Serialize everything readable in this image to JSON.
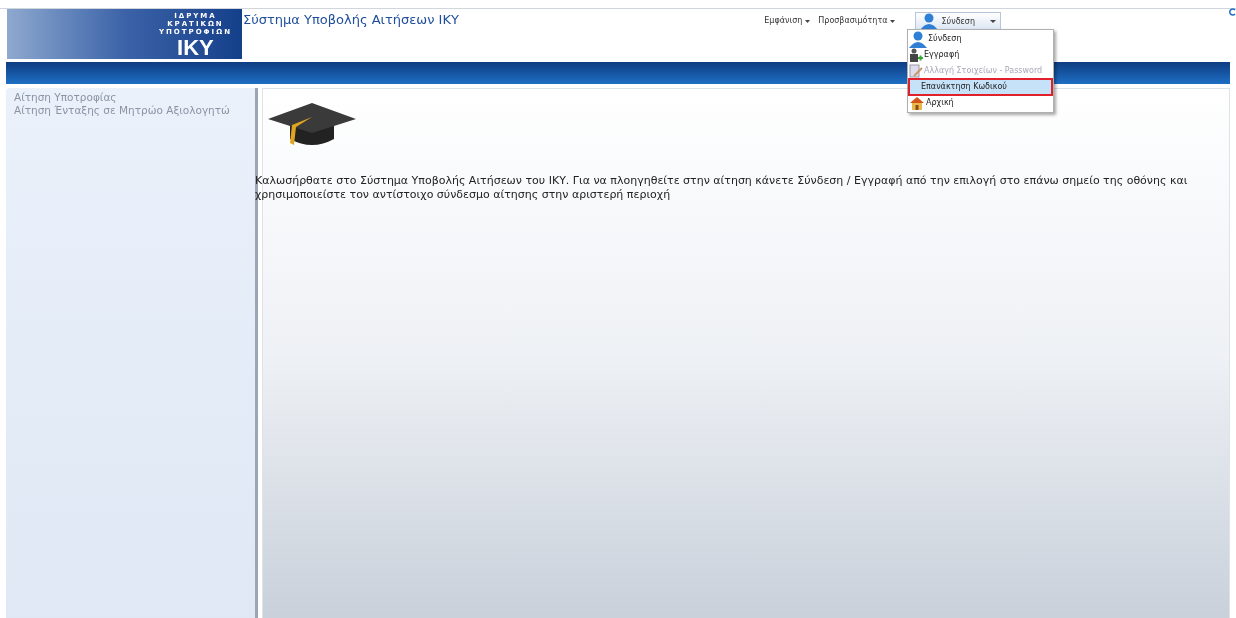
{
  "logo": {
    "lines": [
      "ΙΔΡΥΜΑ",
      "ΚΡΑΤΙΚΩΝ",
      "ΥΠΟΤΡΟΦΙΩΝ"
    ],
    "mark": "IKY"
  },
  "title": "Σύστημα Υποβολής Αιτήσεων ΙΚΥ",
  "top_menu": [
    {
      "label": "Εμφάνιση"
    },
    {
      "label": "Προσβασιμότητα"
    }
  ],
  "account_button": {
    "label": "Σύνδεση",
    "expanded": true
  },
  "account_menu": [
    {
      "label": "Σύνδεση",
      "disabled": false,
      "selected": false
    },
    {
      "label": "Εγγραφή",
      "disabled": false,
      "selected": false
    },
    {
      "label": "Αλλαγή Στοιχείων - Password",
      "disabled": true,
      "selected": false
    },
    {
      "label": "Επανάκτηση Κωδικού",
      "disabled": false,
      "selected": true
    },
    {
      "label": "Αρχική",
      "disabled": false,
      "selected": false
    }
  ],
  "sidebar": {
    "items": [
      {
        "label": "Αίτηση Υποτροφίας"
      },
      {
        "label": "Αίτηση Ένταξης σε Μητρώο Αξιολογητώ"
      }
    ]
  },
  "welcome": "Καλωσήρθατε στο Σύστημα Υποβολής Αιτήσεων του ΙΚΥ. Για να πλοηγηθείτε στην αίτηση κάνετε Σύνδεση / Εγγραφή από την επιλογή στο επάνω σημείο της οθόνης και χρησιμοποιείστε τον αντίστοιχο σύνδεσμο αίτησης στην αριστερή περιοχή"
}
